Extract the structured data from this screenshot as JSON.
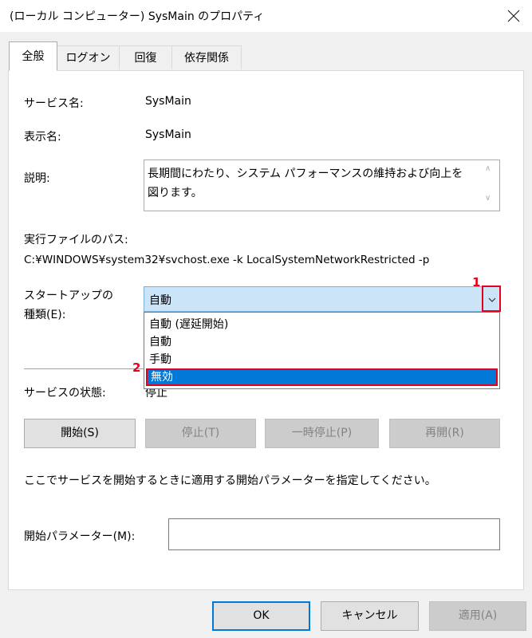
{
  "window": {
    "title": "(ローカル コンピューター) SysMain のプロパティ"
  },
  "tabs": [
    {
      "label": "全般",
      "active": true
    },
    {
      "label": "ログオン",
      "active": false
    },
    {
      "label": "回復",
      "active": false
    },
    {
      "label": "依存関係",
      "active": false
    }
  ],
  "general": {
    "service_name_label": "サービス名:",
    "service_name_value": "SysMain",
    "display_name_label": "表示名:",
    "display_name_value": "SysMain",
    "description_label": "説明:",
    "description_value": "長期間にわたり、システム パフォーマンスの維持および向上を図ります。",
    "path_label": "実行ファイルのパス:",
    "path_value": "C:¥WINDOWS¥system32¥svchost.exe -k LocalSystemNetworkRestricted -p",
    "startup_label_1": "スタートアップの",
    "startup_label_2": "種類(E):",
    "startup_value": "自動",
    "startup_options": [
      "自動 (遅延開始)",
      "自動",
      "手動",
      "無効"
    ],
    "status_label": "サービスの状態:",
    "status_value": "停止",
    "start_button": "開始(S)",
    "stop_button": "停止(T)",
    "pause_button": "一時停止(P)",
    "resume_button": "再開(R)",
    "hint_text": "ここでサービスを開始するときに適用する開始パラメーターを指定してください。",
    "params_label": "開始パラメーター(M):",
    "params_value": ""
  },
  "annotations": {
    "marker_1": "1",
    "marker_2": "2"
  },
  "footer": {
    "ok": "OK",
    "cancel": "キャンセル",
    "apply": "適用(A)"
  },
  "colors": {
    "accent": "#0078d7",
    "highlight_select": "#cce4f7",
    "annotation_red": "#e5001d"
  }
}
